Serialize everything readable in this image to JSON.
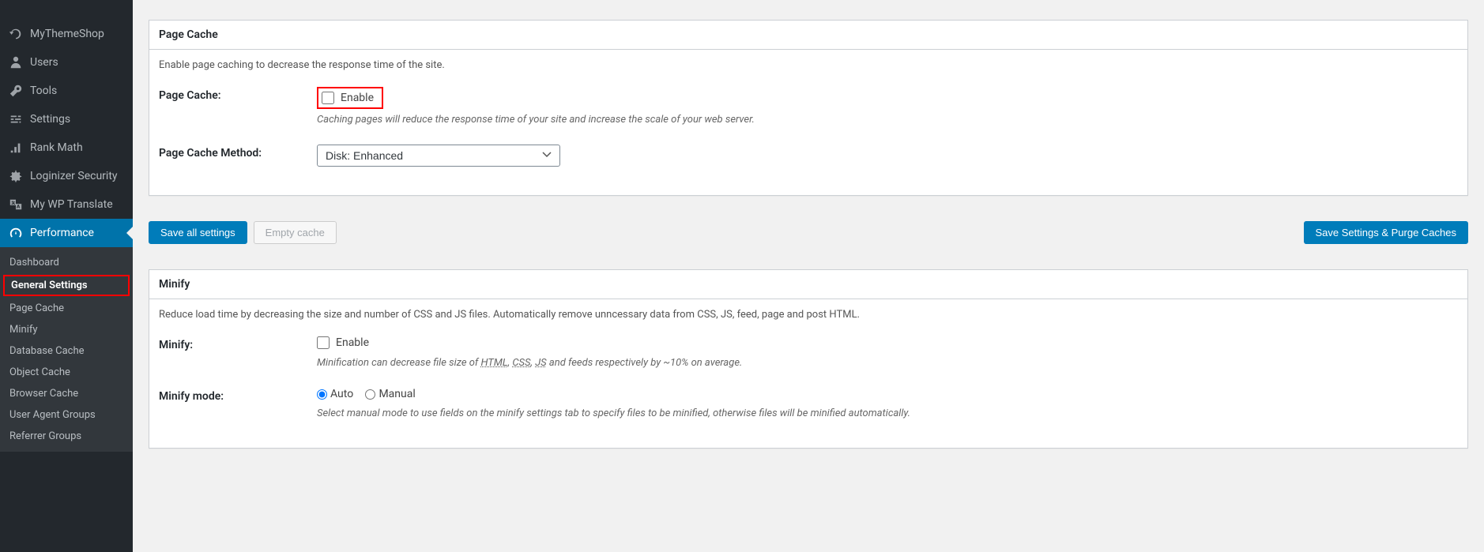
{
  "sidebar": {
    "items": [
      {
        "label": "MyThemeShop"
      },
      {
        "label": "Users"
      },
      {
        "label": "Tools"
      },
      {
        "label": "Settings"
      },
      {
        "label": "Rank Math"
      },
      {
        "label": "Loginizer Security"
      },
      {
        "label": "My WP Translate"
      },
      {
        "label": "Performance"
      }
    ],
    "submenu": [
      {
        "label": "Dashboard"
      },
      {
        "label": "General Settings"
      },
      {
        "label": "Page Cache"
      },
      {
        "label": "Minify"
      },
      {
        "label": "Database Cache"
      },
      {
        "label": "Object Cache"
      },
      {
        "label": "Browser Cache"
      },
      {
        "label": "User Agent Groups"
      },
      {
        "label": "Referrer Groups"
      }
    ]
  },
  "pagecache": {
    "title": "Page Cache",
    "desc": "Enable page caching to decrease the response time of the site.",
    "field_label": "Page Cache:",
    "enable_label": "Enable",
    "enable_desc": "Caching pages will reduce the response time of your site and increase the scale of your web server.",
    "method_label": "Page Cache Method:",
    "method_value": "Disk: Enhanced"
  },
  "buttons": {
    "save_all": "Save all settings",
    "empty_cache": "Empty cache",
    "save_purge": "Save Settings & Purge Caches"
  },
  "minify": {
    "title": "Minify",
    "desc_pre": "Reduce load time by decreasing the size and number of ",
    "desc_css": "CSS",
    "desc_and": " and ",
    "desc_js": "JS",
    "desc_mid": " files. Automatically remove unncessary data from ",
    "desc_css2": "CSS",
    "desc_comma": ", ",
    "desc_js2": "JS",
    "desc_feed": ", feed, page and post ",
    "desc_html": "HTML",
    "desc_end": ".",
    "field_label": "Minify:",
    "enable_label": "Enable",
    "enable_desc_pre": "Minification can decrease file size of ",
    "enable_desc_html": "HTML",
    "enable_desc_c1": ", ",
    "enable_desc_css": "CSS",
    "enable_desc_c2": ", ",
    "enable_desc_js": "JS",
    "enable_desc_post": " and feeds respectively by ~10% on average.",
    "mode_label": "Minify mode:",
    "mode_auto": "Auto",
    "mode_manual": "Manual",
    "mode_desc": "Select manual mode to use fields on the minify settings tab to specify files to be minified, otherwise files will be minified automatically."
  }
}
